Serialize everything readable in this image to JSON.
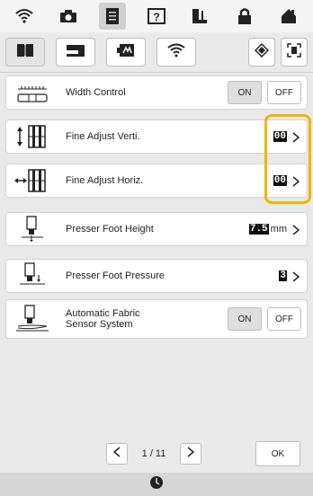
{
  "topbar": {
    "icons": [
      "wifi-icon",
      "camera-icon",
      "document-icon",
      "help-icon",
      "sewing-foot-icon",
      "lock-icon",
      "home-icon"
    ],
    "active_index": 2
  },
  "subtabs": {
    "icons": [
      "book-icon",
      "sewing-machine-icon",
      "embroidery-frame-icon",
      "wifi-icon"
    ],
    "right_icons": [
      "diamond-icon",
      "frame-icon"
    ]
  },
  "rows": [
    {
      "label": "Width Control",
      "on_label": "ON",
      "off_label": "OFF"
    },
    {
      "label": "Fine Adjust Verti.",
      "value": "00"
    },
    {
      "label": "Fine Adjust Horiz.",
      "value": "00"
    },
    {
      "label": "Presser Foot Height",
      "value": "7.5",
      "unit": "mm"
    },
    {
      "label": "Presser Foot Pressure",
      "value": "3"
    },
    {
      "label": "Automatic Fabric Sensor System",
      "on_label": "ON",
      "off_label": "OFF"
    }
  ],
  "pager": {
    "text": "1 / 11"
  },
  "ok_label": "OK",
  "status_icon": "sewing-clock-icon",
  "highlight_color": "#f0b400"
}
